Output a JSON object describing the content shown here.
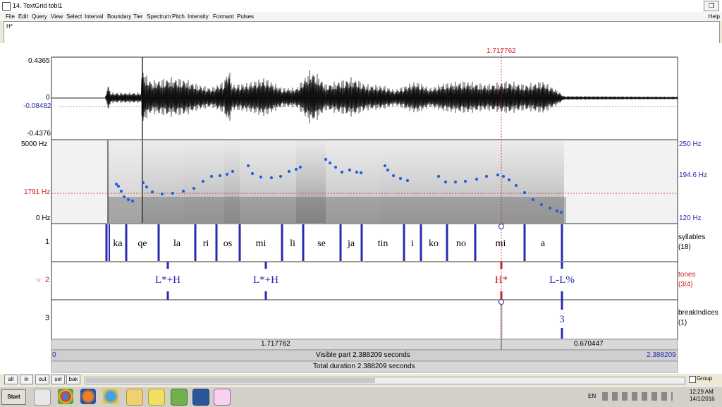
{
  "window": {
    "title": "14. TextGrid tobi1",
    "maximize_label": "❐"
  },
  "menu": [
    "File",
    "Edit",
    "Query",
    "View",
    "Select",
    "Interval",
    "Boundary",
    "Tier",
    "Spectrum",
    "Pitch",
    "Intensity",
    "Formant",
    "Pulses"
  ],
  "help_label": "Help",
  "text_field_value": "H*",
  "cursor_time": "1.717762",
  "waveform": {
    "top_label": "0.4365",
    "zero_label": "0",
    "cursor_label": "-0.08482",
    "bottom_label": "-0.4376"
  },
  "spectrogram": {
    "top_freq": "5000 Hz",
    "cursor_freq": "1791 Hz",
    "bottom_freq": "0 Hz",
    "pitch_top": "250 Hz",
    "pitch_cursor": "194.6 Hz",
    "pitch_bottom": "120 Hz"
  },
  "tiers": [
    {
      "number": "1",
      "name": "syllables",
      "count": "(18)"
    },
    {
      "number": "2",
      "pointer": "☞",
      "name": "tones",
      "count": "(3/4)"
    },
    {
      "number": "3",
      "name": "breakIndices",
      "count": "(1)"
    }
  ],
  "syllables": [
    "ka",
    "qe",
    "la",
    "ri",
    "os",
    "mi",
    "li",
    "se",
    "ja",
    "tin",
    "i",
    "ko",
    "no",
    "mi",
    "a"
  ],
  "tones": [
    "L*+H",
    "L*+H",
    "H*",
    "L-L%"
  ],
  "break_indices": [
    "3"
  ],
  "time_info": {
    "left_segment": "1.717762",
    "right_segment": "0.670447",
    "start": "0",
    "end": "2.388209",
    "visible_part": "Visible part 2.388209 seconds",
    "total_duration": "Total duration 2.388209 seconds"
  },
  "nav_buttons": [
    "all",
    "in",
    "out",
    "sel",
    "bak"
  ],
  "group_label": "Group",
  "taskbar": {
    "start_label": "Start",
    "lang": "EN",
    "clock_time": "12:29 AM",
    "clock_date": "14/1/2016"
  },
  "colors": {
    "pitch": "#1f5fe0",
    "cursor": "#d02020",
    "tier_blue": "#2a2ab0"
  }
}
